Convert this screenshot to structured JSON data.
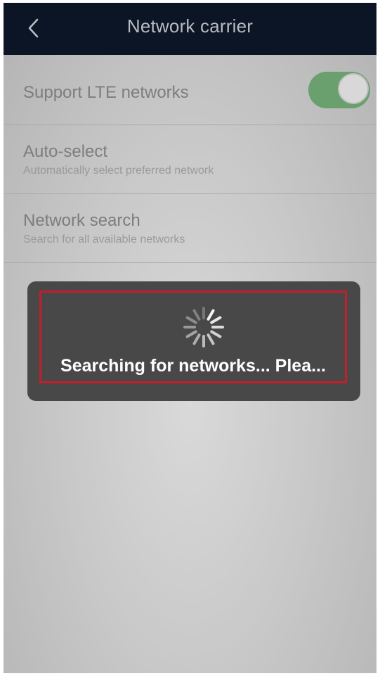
{
  "header": {
    "title": "Network carrier",
    "back_icon": "chevron-left-icon"
  },
  "settings": {
    "lte": {
      "label": "Support LTE networks",
      "enabled": true
    },
    "auto_select": {
      "title": "Auto-select",
      "subtitle": "Automatically select preferred network"
    },
    "network_search": {
      "title": "Network search",
      "subtitle": "Search for all available networks"
    }
  },
  "toast": {
    "message": "Searching for networks... Plea...",
    "icon": "spinner-icon"
  },
  "colors": {
    "header_bg": "#0c1525",
    "toggle_on": "#6a9f6e",
    "toast_bg": "#484848",
    "highlight": "#c41e2c"
  }
}
